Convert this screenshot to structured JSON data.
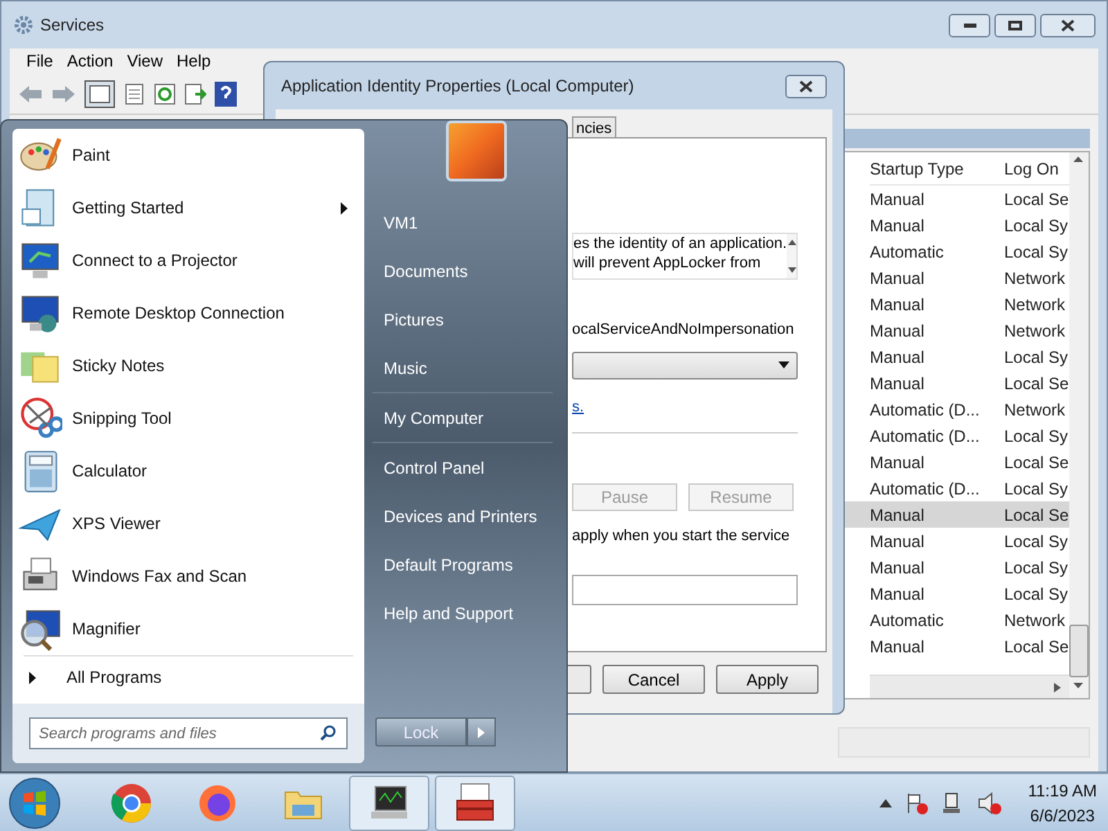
{
  "services_window": {
    "title": "Services",
    "menu": [
      "File",
      "Action",
      "View",
      "Help"
    ],
    "table": {
      "columns": [
        "Startup Type",
        "Log On"
      ],
      "rows": [
        {
          "startup_type": "Manual",
          "log_on": "Local Se",
          "selected": false
        },
        {
          "startup_type": "Manual",
          "log_on": "Local Sy",
          "selected": false
        },
        {
          "startup_type": "Automatic",
          "log_on": "Local Sy",
          "selected": false
        },
        {
          "startup_type": "Manual",
          "log_on": "Network",
          "selected": false
        },
        {
          "startup_type": "Manual",
          "log_on": "Network",
          "selected": false
        },
        {
          "startup_type": "Manual",
          "log_on": "Network",
          "selected": false
        },
        {
          "startup_type": "Manual",
          "log_on": "Local Sy",
          "selected": false
        },
        {
          "startup_type": "Manual",
          "log_on": "Local Se",
          "selected": false
        },
        {
          "startup_type": "Automatic (D...",
          "log_on": "Network",
          "selected": false
        },
        {
          "startup_type": "Automatic (D...",
          "log_on": "Local Sy",
          "selected": false
        },
        {
          "startup_type": "Manual",
          "log_on": "Local Se",
          "selected": false
        },
        {
          "startup_type": "Automatic (D...",
          "log_on": "Local Sy",
          "selected": false
        },
        {
          "startup_type": "Manual",
          "log_on": "Local Se",
          "selected": true
        },
        {
          "startup_type": "Manual",
          "log_on": "Local Sy",
          "selected": false
        },
        {
          "startup_type": "Manual",
          "log_on": "Local Sy",
          "selected": false
        },
        {
          "startup_type": "Manual",
          "log_on": "Local Sy",
          "selected": false
        },
        {
          "startup_type": "Automatic",
          "log_on": "Network",
          "selected": false
        },
        {
          "startup_type": "Manual",
          "log_on": "Local Se",
          "selected": false
        }
      ]
    }
  },
  "dialog": {
    "title": "Application Identity Properties (Local Computer)",
    "tabs": [
      {
        "label": "ncies",
        "selected": false
      }
    ],
    "description_lines": [
      "es the identity of an application.",
      "will prevent AppLocker from"
    ],
    "account": "ocalServiceAndNoImpersonation",
    "link": "s.",
    "service_buttons": [
      {
        "label": "Pause",
        "disabled": true
      },
      {
        "label": "Resume",
        "disabled": true
      }
    ],
    "hint": "apply when you start the service",
    "buttons": [
      {
        "label": "Cancel"
      },
      {
        "label": "Apply"
      }
    ]
  },
  "start_menu": {
    "programs": [
      {
        "label": "Paint",
        "submenu": false
      },
      {
        "label": "Getting Started",
        "submenu": true
      },
      {
        "label": "Connect to a Projector",
        "submenu": false
      },
      {
        "label": "Remote Desktop Connection",
        "submenu": false
      },
      {
        "label": "Sticky Notes",
        "submenu": false
      },
      {
        "label": "Snipping Tool",
        "submenu": false
      },
      {
        "label": "Calculator",
        "submenu": false
      },
      {
        "label": "XPS Viewer",
        "submenu": false
      },
      {
        "label": "Windows Fax and Scan",
        "submenu": false
      },
      {
        "label": "Magnifier",
        "submenu": false
      }
    ],
    "all_programs": "All Programs",
    "search": {
      "placeholder": "Search programs and files"
    },
    "places": [
      [
        "VM1",
        "Documents",
        "Pictures",
        "Music"
      ],
      [
        "My Computer"
      ],
      [
        "Control Panel",
        "Devices and Printers",
        "Default Programs",
        "Help and Support"
      ]
    ],
    "lock_button": "Lock"
  },
  "taskbar": {
    "items": [
      {
        "active": false
      },
      {
        "active": false
      },
      {
        "active": false
      },
      {
        "active": true
      },
      {
        "active": true
      }
    ],
    "time": "11:19 AM",
    "date": "6/6/2023"
  }
}
